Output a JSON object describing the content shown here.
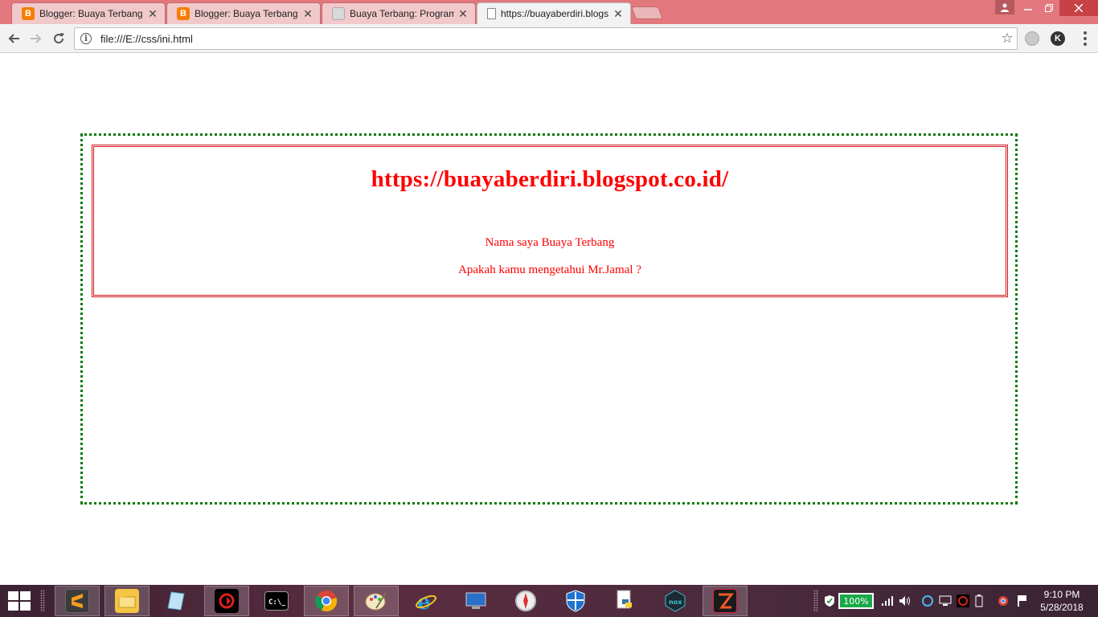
{
  "browser": {
    "tabs": [
      {
        "title": "Blogger: Buaya Terbang -",
        "favicon": "blogger-icon",
        "active": false
      },
      {
        "title": "Blogger: Buaya Terbang -",
        "favicon": "blogger-icon",
        "active": false
      },
      {
        "title": "Buaya Terbang: Program",
        "favicon": "image-icon",
        "active": false
      },
      {
        "title": "https://buayaberdiri.blogs",
        "favicon": "page-icon",
        "active": true
      }
    ],
    "close_glyph": "✕",
    "address": "file:///E://css/ini.html",
    "profile_initial": "K"
  },
  "page": {
    "heading": "https://buayaberdiri.blogspot.co.id/",
    "line1": "Nama saya Buaya Terbang",
    "line2": "Apakah kamu mengetahui Mr.Jamal ?",
    "colors": {
      "heading": "#ff0000",
      "inner_border": "#d0141a",
      "outer_border": "#0a7a0a"
    }
  },
  "taskbar": {
    "battery": "100%",
    "time": "9:10 PM",
    "date": "5/28/2018",
    "apps": [
      "sublime-text-icon",
      "file-explorer-icon",
      "notepad-icon",
      "garena-icon",
      "command-prompt-icon",
      "chrome-icon",
      "paint-icon",
      "internet-explorer-icon",
      "remote-desktop-icon",
      "compass-icon",
      "windows-defender-icon",
      "python-icon",
      "nox-icon",
      "game-launcher-icon"
    ]
  }
}
